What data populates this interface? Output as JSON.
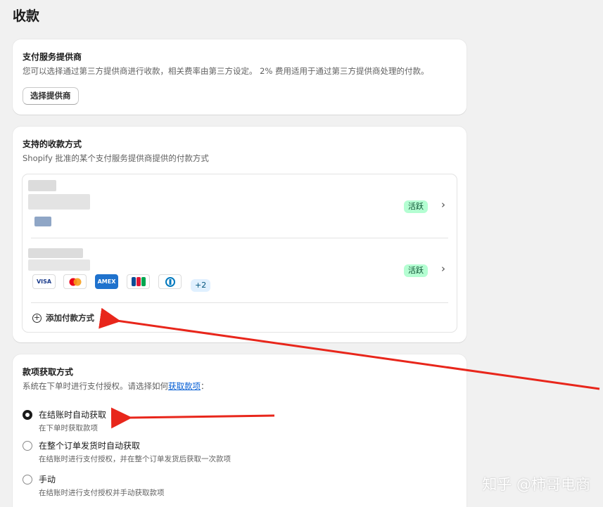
{
  "page": {
    "title": "收款"
  },
  "provider_card": {
    "title": "支付服务提供商",
    "description": "您可以选择通过第三方提供商进行收款，相关费率由第三方设定。 2% 费用适用于通过第三方提供商处理的付款。",
    "button_label": "选择提供商"
  },
  "methods_card": {
    "title": "支持的收款方式",
    "description": "Shopify 批准的某个支付服务提供商提供的付款方式",
    "rows": [
      {
        "status": "活跃"
      },
      {
        "status": "活跃"
      }
    ],
    "card_icons": [
      "VISA",
      "Mastercard",
      "AMEX",
      "JCB",
      "Diners"
    ],
    "more_label": "+2",
    "add_label": "添加付款方式"
  },
  "capture_card": {
    "title": "款项获取方式",
    "description_prefix": "系统在下单时进行支付授权。请选择如何",
    "description_link": "获取款项",
    "description_suffix": "：",
    "options": [
      {
        "label": "在结账时自动获取",
        "help": "在下单时获取款项",
        "selected": true
      },
      {
        "label": "在整个订单发货时自动获取",
        "help": "在结账时进行支付授权，并在整个订单发货后获取一次款项",
        "selected": false
      },
      {
        "label": "手动",
        "help": "在结账时进行支付授权并手动获取款项",
        "selected": false
      }
    ]
  },
  "watermark": "知乎 @柿哥电商",
  "colors": {
    "accent_link": "#005bd3",
    "badge_bg": "#b4fed2",
    "arrow": "#e8261b"
  }
}
